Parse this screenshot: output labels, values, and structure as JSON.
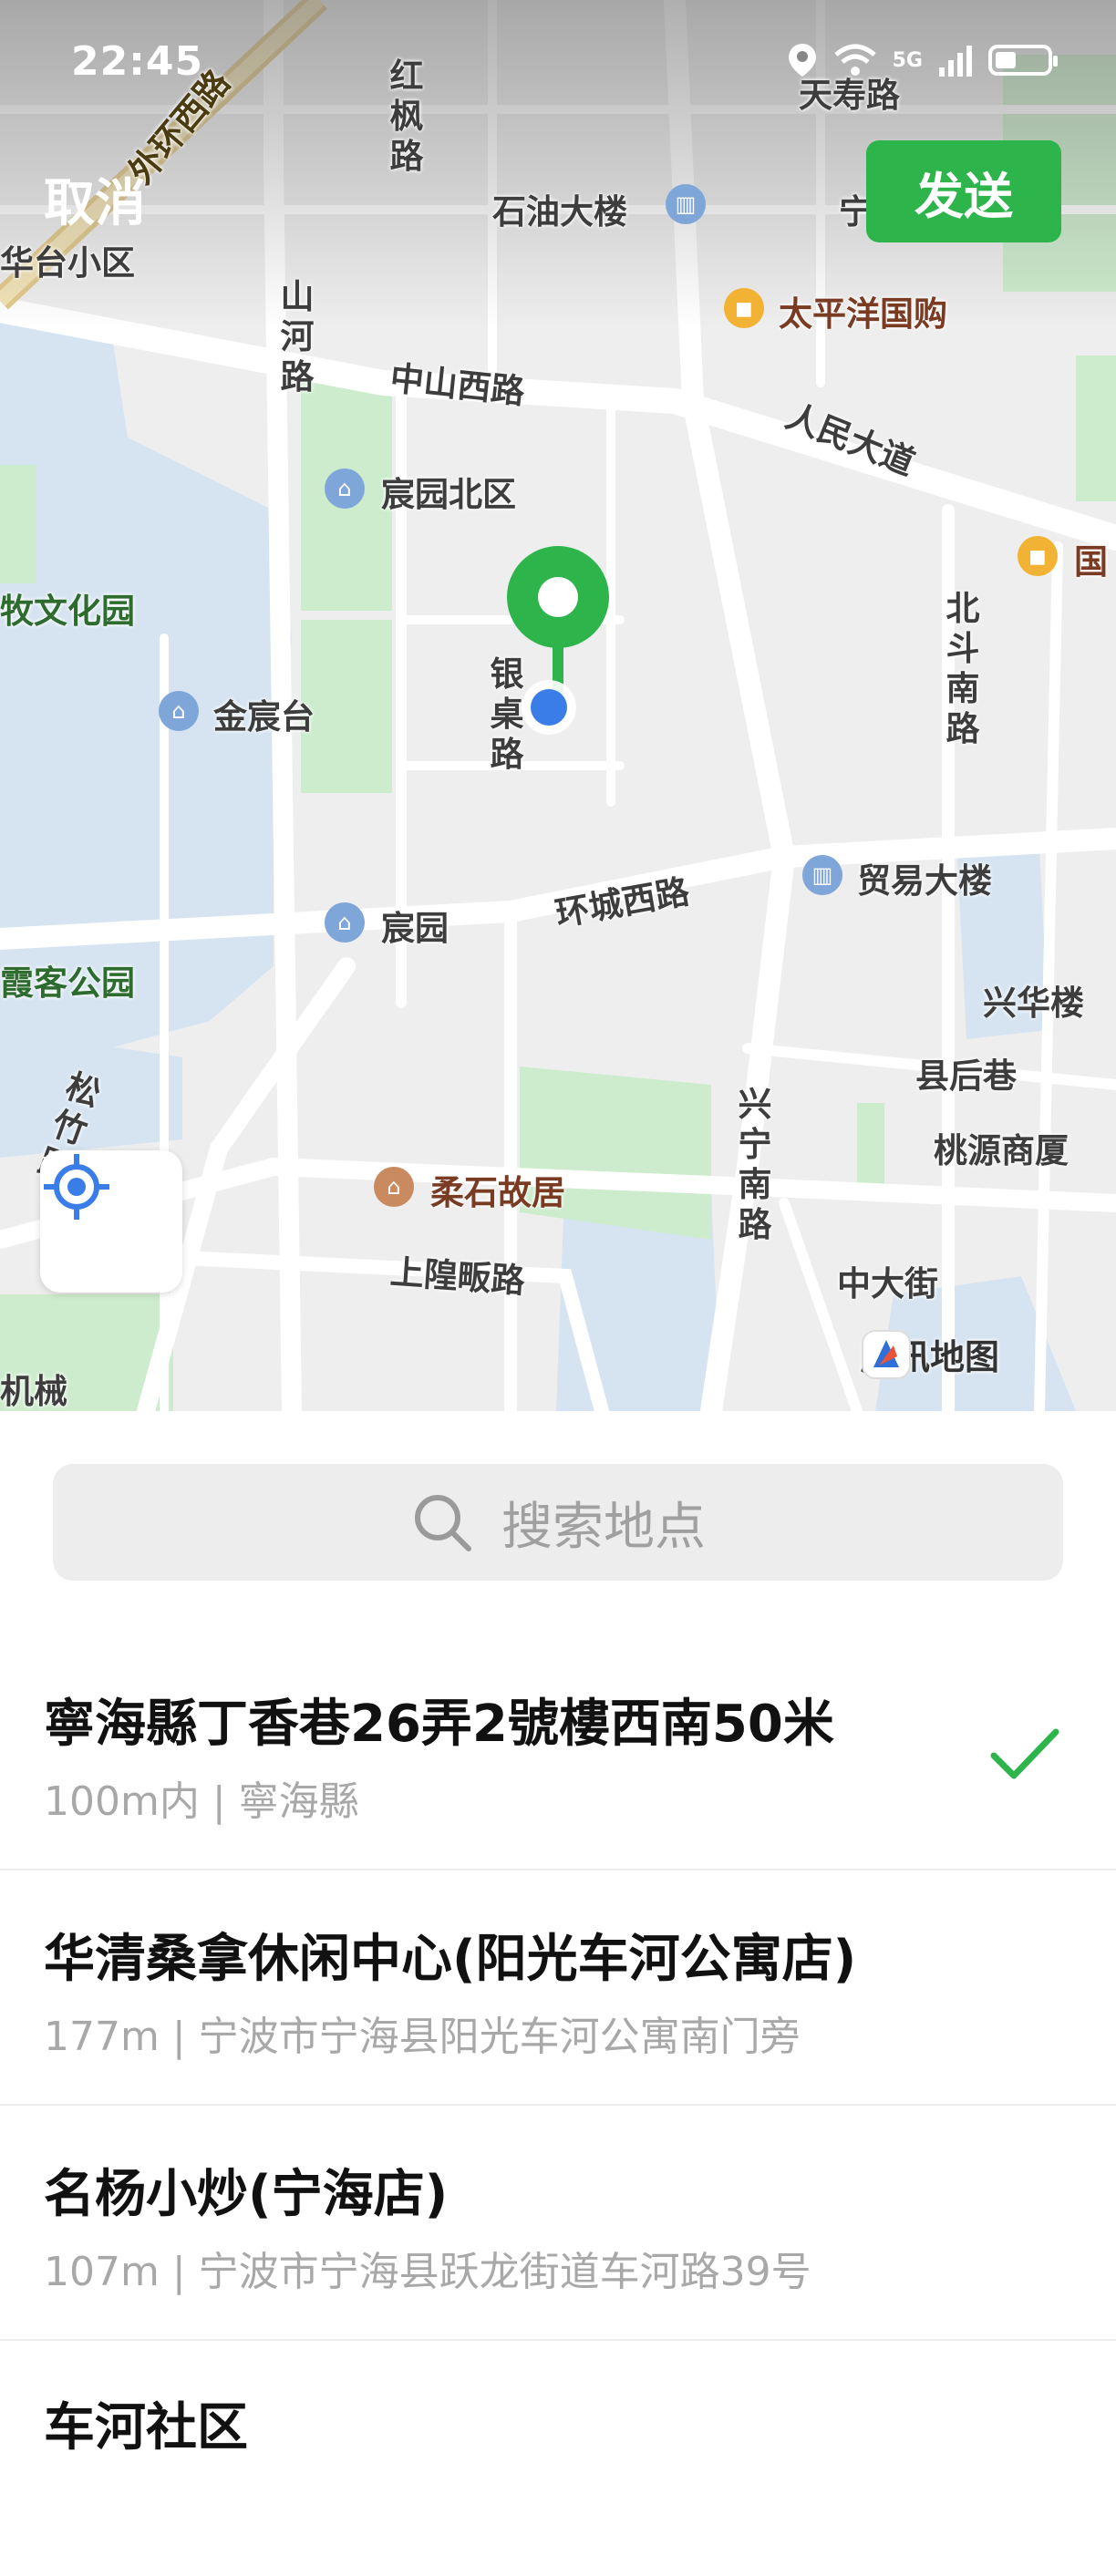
{
  "status_bar": {
    "time": "22:45",
    "network": "5G"
  },
  "header": {
    "cancel_label": "取消",
    "send_label": "发送"
  },
  "map": {
    "roads": {
      "hongfeng": "红枫路",
      "shanhe": "山河路",
      "zhongshan_west": "中山西路",
      "renmin": "人民大道",
      "beidou_south": "北斗南路",
      "huancheng_west": "环城西路",
      "yinhe": "银\n桌\n路",
      "xingning_south": "兴宁南路",
      "shanghuang": "上隍畈路",
      "zhongda": "中大街",
      "xianhou": "县后巷",
      "songzhu": "松竹路",
      "ring_west": "外环西路",
      "tianshou": "天寿路"
    },
    "pois": {
      "shiyou": "石油大楼",
      "taipingyang": "太平洋国购",
      "chenyuan_north": "宸园北区",
      "jinchen": "金宸台",
      "chenyuan": "宸园",
      "maoyi": "贸易大楼",
      "xinghua": "兴华楼",
      "taoyuan": "桃源商厦",
      "roushi": "柔石故居",
      "huatai": "华台小区",
      "muwenhua": "牧文化园",
      "xiake": "霞客公园",
      "guo": "国",
      "jixie": "机械",
      "ning": "宁"
    },
    "attribution": "腾讯地图",
    "colors": {
      "road": "#ffffff",
      "block": "#eeeeee",
      "park": "#cdeccd",
      "water": "#d6e4f2",
      "pin": "#2db54c",
      "location": "#3a7de8"
    }
  },
  "search": {
    "placeholder": "搜索地点"
  },
  "results": [
    {
      "title": "寧海縣丁香巷26弄2號樓西南50米",
      "subtitle": "100m内 | 寧海縣",
      "selected": true
    },
    {
      "title": "华清桑拿休闲中心(阳光车河公寓店)",
      "subtitle": "177m | 宁波市宁海县阳光车河公寓南门旁",
      "selected": false
    },
    {
      "title": "名杨小炒(宁海店)",
      "subtitle": "107m | 宁波市宁海县跃龙街道车河路39号",
      "selected": false
    },
    {
      "title": "车河社区",
      "subtitle": "",
      "selected": false
    }
  ]
}
